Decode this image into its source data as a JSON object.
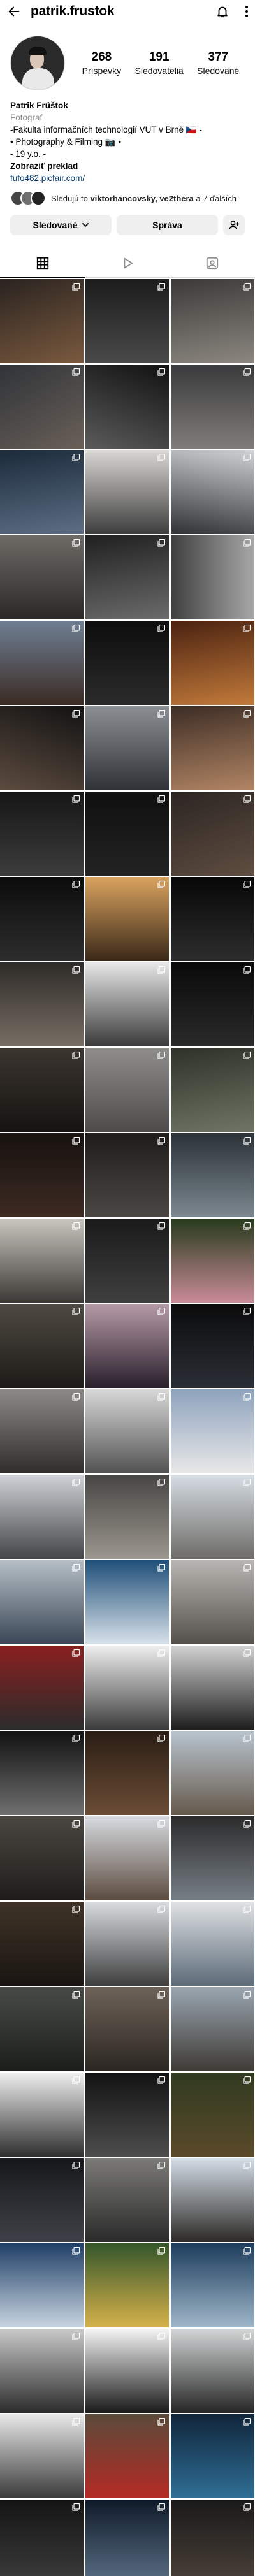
{
  "header": {
    "username": "patrik.frustok",
    "back_icon": "back-arrow-icon",
    "bell_icon": "bell-icon",
    "more_icon": "more-vertical-icon"
  },
  "profile": {
    "stats": [
      {
        "value": "268",
        "label": "Príspevky"
      },
      {
        "value": "191",
        "label": "Sledovatelia"
      },
      {
        "value": "377",
        "label": "Sledované"
      }
    ]
  },
  "bio": {
    "name": "Patrik Frúštok",
    "category": "Fotograf",
    "line1": "-Fakulta informačních technologií VUT v Brně 🇨🇿 -",
    "line2": "• Photography & Filming 📷 •",
    "line3": "- 19 y.o. -",
    "translate": "Zobraziť preklad",
    "link": "fufo482.picfair.com/"
  },
  "mutual": {
    "prefix": "Sledujú to ",
    "names": "viktorhancovsky, ve2thera",
    "suffix": " a 7 ďalších"
  },
  "actions": {
    "following_label": "Sledované",
    "message_label": "Správa"
  },
  "tabs": {
    "grid_icon": "grid-icon",
    "reels_icon": "reels-icon",
    "tagged_icon": "tagged-icon"
  },
  "posts": [
    {
      "c": [
        "#2a2320",
        "#7a5a3e"
      ],
      "d": "160deg"
    },
    {
      "c": [
        "#1c1c1c",
        "#4a4a4a"
      ],
      "d": "180deg"
    },
    {
      "c": [
        "#3b3a38",
        "#8c8780"
      ],
      "d": "170deg"
    },
    {
      "c": [
        "#2f3338",
        "#6a6058"
      ],
      "d": "150deg"
    },
    {
      "c": [
        "#111111",
        "#5b5b5b"
      ],
      "d": "200deg"
    },
    {
      "c": [
        "#3a3a3c",
        "#7f7d79"
      ],
      "d": "180deg"
    },
    {
      "c": [
        "#1b2a3a",
        "#5d6f85"
      ],
      "d": "170deg"
    },
    {
      "c": [
        "#dad8d4",
        "#3d3d3d"
      ],
      "d": "180deg"
    },
    {
      "c": [
        "#cfd3d6",
        "#2f3134"
      ],
      "d": "190deg"
    },
    {
      "c": [
        "#6d6a66",
        "#2a2826"
      ],
      "d": "180deg"
    },
    {
      "c": [
        "#202020",
        "#6b6b6b"
      ],
      "d": "170deg"
    },
    {
      "c": [
        "#3f3f3f",
        "#a8a8a8"
      ],
      "d": "90deg"
    },
    {
      "c": [
        "#6e7f93",
        "#3b2b24"
      ],
      "d": "180deg"
    },
    {
      "c": [
        "#0d0d0d",
        "#2b2b2b"
      ],
      "d": "180deg"
    },
    {
      "c": [
        "#4a2210",
        "#c27a3a"
      ],
      "d": "170deg"
    },
    {
      "c": [
        "#121212",
        "#5c4b3f"
      ],
      "d": "200deg"
    },
    {
      "c": [
        "#8b8f94",
        "#2f3236"
      ],
      "d": "180deg"
    },
    {
      "c": [
        "#3c2d25",
        "#b28564"
      ],
      "d": "170deg"
    },
    {
      "c": [
        "#161616",
        "#3c3c3c"
      ],
      "d": "180deg"
    },
    {
      "c": [
        "#0f0f0f",
        "#232323"
      ],
      "d": "180deg"
    },
    {
      "c": [
        "#2b2522",
        "#5f4d40"
      ],
      "d": "160deg"
    },
    {
      "c": [
        "#0c0c0c",
        "#2d2d2d"
      ],
      "d": "180deg"
    },
    {
      "c": [
        "#d9a35f",
        "#3a2818"
      ],
      "d": "180deg"
    },
    {
      "c": [
        "#070707",
        "#2d2d2d"
      ],
      "d": "180deg"
    },
    {
      "c": [
        "#2e2b28",
        "#786e64"
      ],
      "d": "180deg"
    },
    {
      "c": [
        "#e8e8e8",
        "#3a3a3a"
      ],
      "d": "180deg"
    },
    {
      "c": [
        "#0a0a0a",
        "#2a2a2a"
      ],
      "d": "180deg"
    },
    {
      "c": [
        "#3b352f",
        "#151311"
      ],
      "d": "180deg"
    },
    {
      "c": [
        "#8f8e8b",
        "#4c4b49"
      ],
      "d": "180deg"
    },
    {
      "c": [
        "#2e3127",
        "#6f7566"
      ],
      "d": "170deg"
    },
    {
      "c": [
        "#17120f",
        "#3d2a22"
      ],
      "d": "180deg"
    },
    {
      "c": [
        "#1e1c1a",
        "#4b4744"
      ],
      "d": "180deg"
    },
    {
      "c": [
        "#2b3238",
        "#7c8890"
      ],
      "d": "180deg"
    },
    {
      "c": [
        "#c9c6bf",
        "#3b3935"
      ],
      "d": "180deg"
    },
    {
      "c": [
        "#1a1a1a",
        "#3f3f3f"
      ],
      "d": "180deg"
    },
    {
      "c": [
        "#263a1c",
        "#c98b97"
      ],
      "d": "180deg"
    },
    {
      "c": [
        "#4f4a42",
        "#1c1a17"
      ],
      "d": "180deg"
    },
    {
      "c": [
        "#b59aa6",
        "#2a1f2c"
      ],
      "d": "180deg"
    },
    {
      "c": [
        "#0b0b0b",
        "#2a2f36"
      ],
      "d": "180deg"
    },
    {
      "c": [
        "#8c8a86",
        "#2e2d2b"
      ],
      "d": "180deg"
    },
    {
      "c": [
        "#d8d8d8",
        "#525252"
      ],
      "d": "180deg"
    },
    {
      "c": [
        "#8ea3bd",
        "#e8e8e8"
      ],
      "d": "180deg"
    },
    {
      "c": [
        "#cfd2d6",
        "#434548"
      ],
      "d": "180deg"
    },
    {
      "c": [
        "#474644",
        "#9b968e"
      ],
      "d": "180deg"
    },
    {
      "c": [
        "#d6dde4",
        "#6d6b67"
      ],
      "d": "180deg"
    },
    {
      "c": [
        "#b6bfc6",
        "#3a4656"
      ],
      "d": "180deg"
    },
    {
      "c": [
        "#1f4f78",
        "#d8e2ea"
      ],
      "d": "180deg"
    },
    {
      "c": [
        "#b8b6b2",
        "#53504c"
      ],
      "d": "180deg"
    },
    {
      "c": [
        "#8a1f1f",
        "#2c2c2c"
      ],
      "d": "180deg"
    },
    {
      "c": [
        "#efefef",
        "#3c3c3c"
      ],
      "d": "180deg"
    },
    {
      "c": [
        "#d2d2d2",
        "#1d1d1d"
      ],
      "d": "180deg"
    },
    {
      "c": [
        "#111111",
        "#6f6f6f"
      ],
      "d": "180deg"
    },
    {
      "c": [
        "#2a1d14",
        "#6b4d36"
      ],
      "d": "180deg"
    },
    {
      "c": [
        "#b9c5cf",
        "#65594c"
      ],
      "d": "180deg"
    },
    {
      "c": [
        "#4a4640",
        "#1f1d1b"
      ],
      "d": "180deg"
    },
    {
      "c": [
        "#d7dbe0",
        "#5b4b3f"
      ],
      "d": "180deg"
    },
    {
      "c": [
        "#2b2b2b",
        "#777f86"
      ],
      "d": "180deg"
    },
    {
      "c": [
        "#3f3327",
        "#1a1511"
      ],
      "d": "180deg"
    },
    {
      "c": [
        "#d9dde0",
        "#3e3e3e"
      ],
      "d": "180deg"
    },
    {
      "c": [
        "#e0e2e4",
        "#5c6b78"
      ],
      "d": "180deg"
    },
    {
      "c": [
        "#474a45",
        "#1c1e1b"
      ],
      "d": "180deg"
    },
    {
      "c": [
        "#6e6258",
        "#2b2622"
      ],
      "d": "180deg"
    },
    {
      "c": [
        "#9aa6b0",
        "#3e3a35"
      ],
      "d": "180deg"
    },
    {
      "c": [
        "#f0f0f0",
        "#2f2f2f"
      ],
      "d": "180deg"
    },
    {
      "c": [
        "#121212",
        "#4d4d4d"
      ],
      "d": "180deg"
    },
    {
      "c": [
        "#2f3a20",
        "#5b4a2a"
      ],
      "d": "180deg"
    },
    {
      "c": [
        "#16171a",
        "#3e4248"
      ],
      "d": "180deg"
    },
    {
      "c": [
        "#7b7a77",
        "#2a2a2a"
      ],
      "d": "180deg"
    },
    {
      "c": [
        "#d4dee8",
        "#2c2a26"
      ],
      "d": "180deg"
    },
    {
      "c": [
        "#1f3f66",
        "#c8d5e1"
      ],
      "d": "180deg"
    },
    {
      "c": [
        "#34562a",
        "#d6b24a"
      ],
      "d": "180deg"
    },
    {
      "c": [
        "#1c3c5c",
        "#9fb7c9"
      ],
      "d": "180deg"
    },
    {
      "c": [
        "#c9c9c9",
        "#2c2c2c"
      ],
      "d": "180deg"
    },
    {
      "c": [
        "#f5f5f5",
        "#1a1a1a"
      ],
      "d": "180deg"
    },
    {
      "c": [
        "#d3d5d6",
        "#262626"
      ],
      "d": "180deg"
    },
    {
      "c": [
        "#e9e9e9",
        "#3a3a3a"
      ],
      "d": "180deg"
    },
    {
      "c": [
        "#5a4a3a",
        "#b52a24"
      ],
      "d": "180deg"
    },
    {
      "c": [
        "#10253a",
        "#2f6f96"
      ],
      "d": "180deg"
    },
    {
      "c": [
        "#141414",
        "#3c3c3c"
      ],
      "d": "180deg"
    },
    {
      "c": [
        "#0f1a28",
        "#5a6f85"
      ],
      "d": "180deg"
    },
    {
      "c": [
        "#1a1a1a",
        "#4a4038"
      ],
      "d": "180deg"
    }
  ]
}
